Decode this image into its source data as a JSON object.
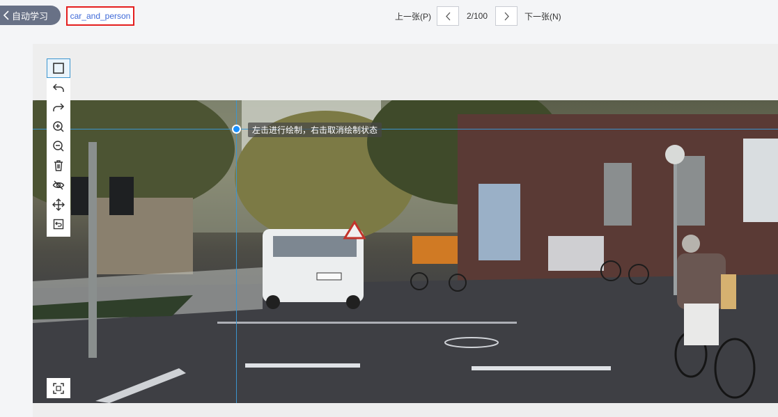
{
  "header": {
    "back_label": "自动学习",
    "dataset_name": "car_and_person"
  },
  "pager": {
    "prev_label": "上一张(P)",
    "count": "2/100",
    "next_label": "下一张(N)"
  },
  "canvas": {
    "hint": "左击进行绘制，右击取消绘制状态"
  },
  "toolbar": {
    "tools": [
      {
        "icon": "rectangle-icon",
        "active": true
      },
      {
        "icon": "undo-icon"
      },
      {
        "icon": "redo-icon"
      },
      {
        "icon": "zoom-in-icon"
      },
      {
        "icon": "zoom-out-icon"
      },
      {
        "icon": "delete-icon"
      },
      {
        "icon": "hide-icon"
      },
      {
        "icon": "move-icon"
      },
      {
        "icon": "reset-icon"
      }
    ],
    "fullscreen_icon": "fullscreen-icon"
  },
  "colors": {
    "accent": "#1890ff",
    "back_button": "#687186",
    "dataset_border": "#e41e1e",
    "dataset_text": "#3f6ad8",
    "crosshair": "#3b95cf"
  }
}
